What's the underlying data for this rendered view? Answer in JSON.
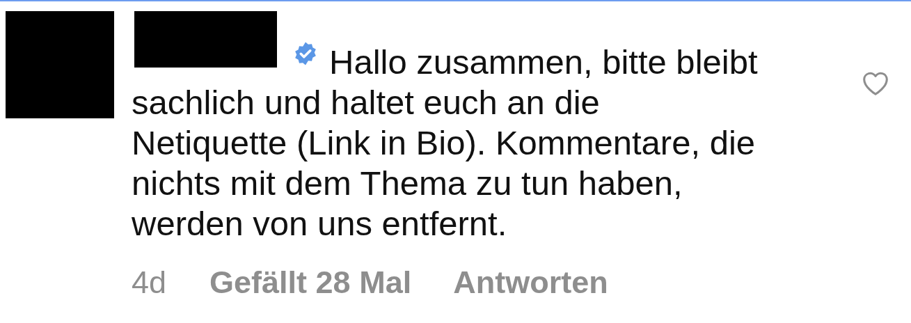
{
  "comment": {
    "verified": true,
    "text": "Hallo zusammen, bitte bleibt\nsachlich und haltet euch an die\nNetiquette (Link in Bio). Kommentare, die\nnichts mit dem Thema zu tun haben,\nwerden von uns entfernt.",
    "liked": false,
    "age": "4d",
    "likes": "Gefällt 28 Mal",
    "reply": "Antworten"
  }
}
